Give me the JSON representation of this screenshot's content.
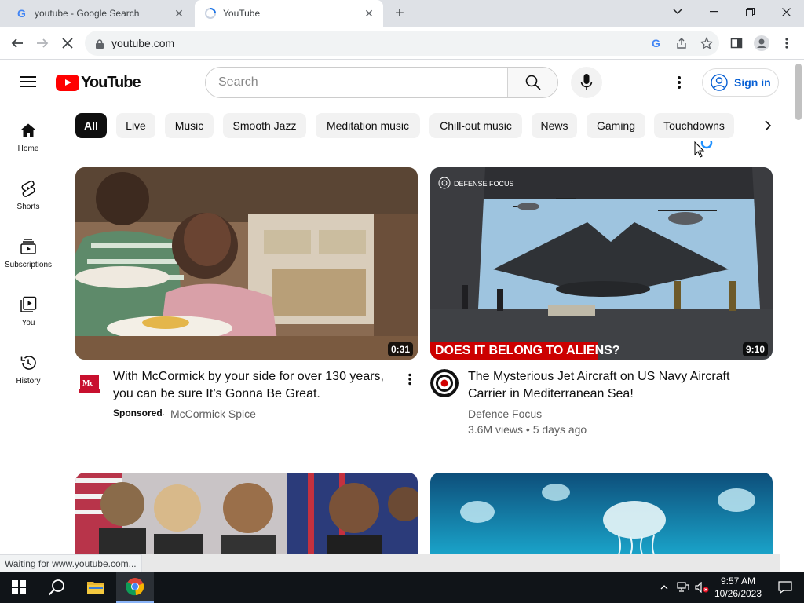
{
  "browser": {
    "tabs": [
      {
        "title": "youtube - Google Search",
        "favicon": "google-icon"
      },
      {
        "title": "YouTube",
        "favicon": "loading-icon"
      }
    ],
    "url": "youtube.com",
    "status_text": "Waiting for www.youtube.com..."
  },
  "youtube": {
    "logo_text": "YouTube",
    "search_placeholder": "Search",
    "sign_in": "Sign in",
    "chips": [
      "All",
      "Live",
      "Music",
      "Smooth Jazz",
      "Meditation music",
      "Chill-out music",
      "News",
      "Gaming",
      "Touchdowns"
    ],
    "guide": [
      {
        "label": "Home",
        "icon": "home-icon"
      },
      {
        "label": "Shorts",
        "icon": "shorts-icon"
      },
      {
        "label": "Subscriptions",
        "icon": "subscriptions-icon"
      },
      {
        "label": "You",
        "icon": "you-icon"
      },
      {
        "label": "History",
        "icon": "history-icon"
      }
    ],
    "videos": [
      {
        "title": "With McCormick by your side for over 130 years, you can be sure It’s Gonna Be Great.",
        "sponsored": "Sponsored",
        "channel": "McCormick Spice",
        "duration": "0:31"
      },
      {
        "title": "The Mysterious Jet Aircraft on US Navy Aircraft Carrier in Mediterranean Sea!",
        "channel": "Defence Focus",
        "meta": "3.6M views • 5 days ago",
        "duration": "9:10",
        "overlay_text": "DOES IT BELONG TO ALIENS?",
        "watermark": "DEFENSE FOCUS"
      }
    ]
  },
  "taskbar": {
    "time": "9:57 AM",
    "date": "10/26/2023"
  }
}
